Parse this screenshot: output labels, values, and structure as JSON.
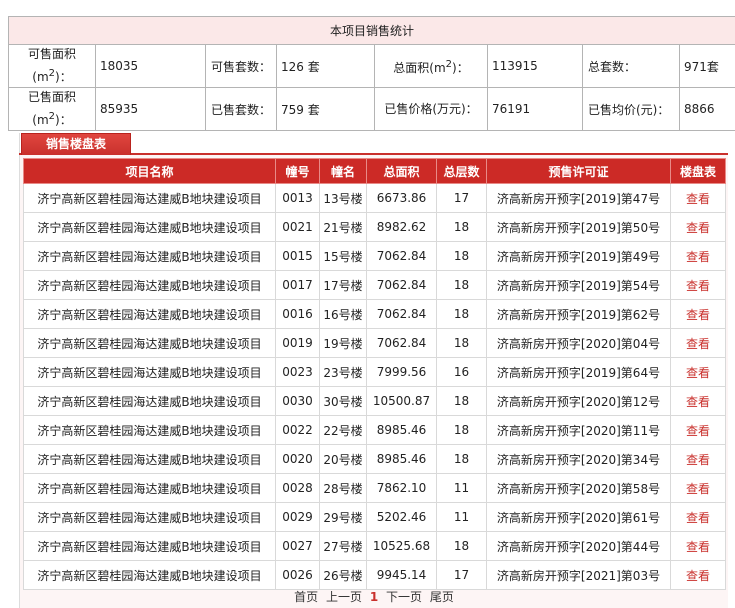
{
  "stats": {
    "title": "本项目销售统计",
    "row1": {
      "l1": "可售面积",
      "l1_unit": "(m",
      "l1_sup": "2",
      "l1_end": ")：",
      "v1": "18035",
      "l2": "可售套数：",
      "v2": "126 套",
      "l3": "总面积(m",
      "l3_sup": "2",
      "l3_end": ")：",
      "v3": "113915",
      "l4": "总套数：",
      "v4": "971套"
    },
    "row2": {
      "l1": "已售面积",
      "l1_unit": "(m",
      "l1_sup": "2",
      "l1_end": ")：",
      "v1": "85935",
      "l2": "已售套数：",
      "v2": "759 套",
      "l3": "已售价格(万元)：",
      "v3": "76191",
      "l4": "已售均价(元)：",
      "v4": "8866"
    }
  },
  "tab": {
    "label": "销售楼盘表"
  },
  "houses": {
    "headers": [
      "项目名称",
      "幢号",
      "幢名",
      "总面积",
      "总层数",
      "预售许可证",
      "楼盘表"
    ],
    "view_label": "查看",
    "rows": [
      [
        "济宁高新区碧桂园海达建威B地块建设项目",
        "0013",
        "13号楼",
        "6673.86",
        "17",
        "济高新房开预字[2019]第47号"
      ],
      [
        "济宁高新区碧桂园海达建威B地块建设项目",
        "0021",
        "21号楼",
        "8982.62",
        "18",
        "济高新房开预字[2019]第50号"
      ],
      [
        "济宁高新区碧桂园海达建威B地块建设项目",
        "0015",
        "15号楼",
        "7062.84",
        "18",
        "济高新房开预字[2019]第49号"
      ],
      [
        "济宁高新区碧桂园海达建威B地块建设项目",
        "0017",
        "17号楼",
        "7062.84",
        "18",
        "济高新房开预字[2019]第54号"
      ],
      [
        "济宁高新区碧桂园海达建威B地块建设项目",
        "0016",
        "16号楼",
        "7062.84",
        "18",
        "济高新房开预字[2019]第62号"
      ],
      [
        "济宁高新区碧桂园海达建威B地块建设项目",
        "0019",
        "19号楼",
        "7062.84",
        "18",
        "济高新房开预字[2020]第04号"
      ],
      [
        "济宁高新区碧桂园海达建威B地块建设项目",
        "0023",
        "23号楼",
        "7999.56",
        "16",
        "济高新房开预字[2019]第64号"
      ],
      [
        "济宁高新区碧桂园海达建威B地块建设项目",
        "0030",
        "30号楼",
        "10500.87",
        "18",
        "济高新房开预字[2020]第12号"
      ],
      [
        "济宁高新区碧桂园海达建威B地块建设项目",
        "0022",
        "22号楼",
        "8985.46",
        "18",
        "济高新房开预字[2020]第11号"
      ],
      [
        "济宁高新区碧桂园海达建威B地块建设项目",
        "0020",
        "20号楼",
        "8985.46",
        "18",
        "济高新房开预字[2020]第34号"
      ],
      [
        "济宁高新区碧桂园海达建威B地块建设项目",
        "0028",
        "28号楼",
        "7862.10",
        "11",
        "济高新房开预字[2020]第58号"
      ],
      [
        "济宁高新区碧桂园海达建威B地块建设项目",
        "0029",
        "29号楼",
        "5202.46",
        "11",
        "济高新房开预字[2020]第61号"
      ],
      [
        "济宁高新区碧桂园海达建威B地块建设项目",
        "0027",
        "27号楼",
        "10525.68",
        "18",
        "济高新房开预字[2020]第44号"
      ],
      [
        "济宁高新区碧桂园海达建威B地块建设项目",
        "0026",
        "26号楼",
        "9945.14",
        "17",
        "济高新房开预字[2021]第03号"
      ]
    ]
  },
  "pager": {
    "first": "首页",
    "prev": "上一页",
    "current": "1",
    "next": "下一页",
    "last": "尾页"
  }
}
